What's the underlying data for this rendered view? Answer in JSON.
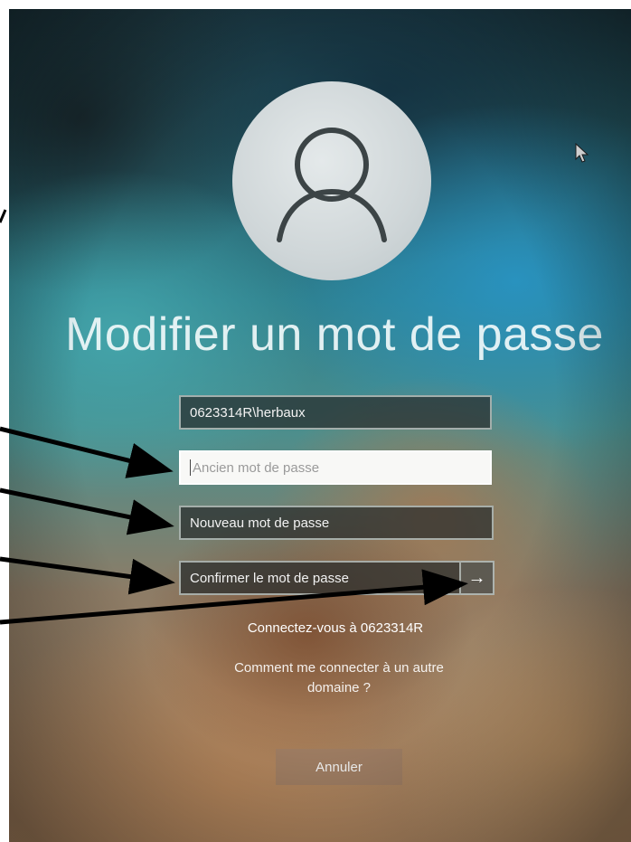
{
  "screen": {
    "title": "Modifier un mot de passe",
    "avatar_icon": "user-silhouette-icon"
  },
  "form": {
    "username_value": "0623314R\\herbaux",
    "old_password_placeholder": "Ancien mot de passe",
    "new_password_placeholder": "Nouveau mot de passe",
    "confirm_password_placeholder": "Confirmer le mot de passe",
    "submit_icon": "arrow-right-icon",
    "submit_glyph": "→"
  },
  "links": {
    "connect_to": "Connectez-vous à 0623314R",
    "other_domain": "Comment me connecter à un autre domaine ?"
  },
  "buttons": {
    "cancel_label": "Annuler"
  },
  "colors": {
    "field_focused_bg": "#f8f8f6",
    "field_bg": "#2d3232",
    "annotation_arrow": "#000000"
  }
}
